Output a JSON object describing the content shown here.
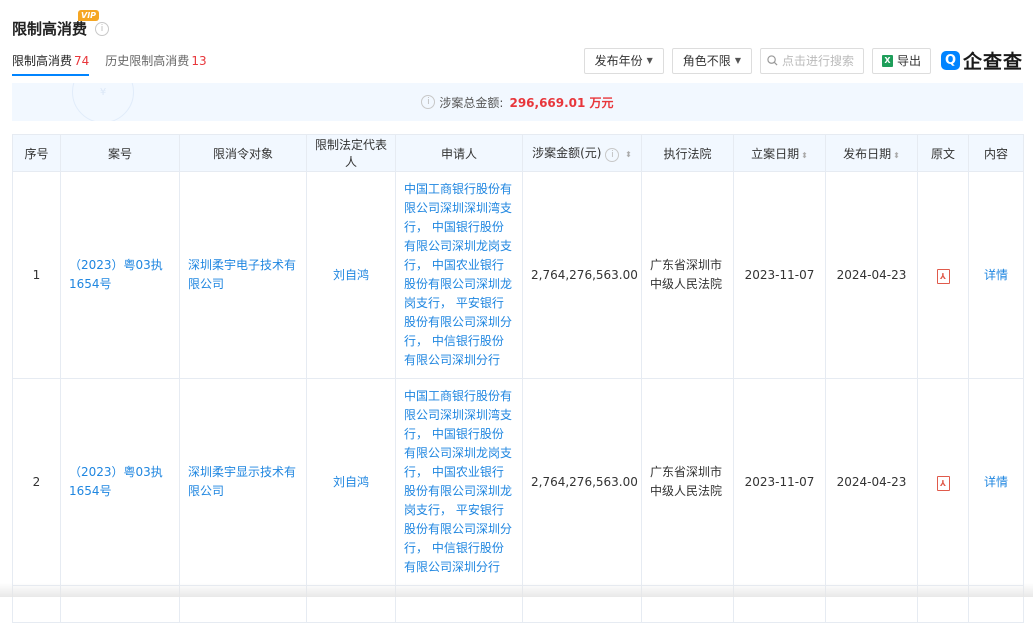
{
  "header": {
    "title": "限制高消费",
    "vip_badge": "VIP",
    "info_icon": "info-icon"
  },
  "tabs": [
    {
      "label": "限制高消费",
      "count": "74",
      "active": true
    },
    {
      "label": "历史限制高消费",
      "count": "13",
      "active": false
    }
  ],
  "toolbar": {
    "year_filter": "发布年份",
    "role_filter": "角色不限",
    "search_placeholder": "点击进行搜索",
    "export_label": "导出",
    "logo_text": "企查查"
  },
  "summary": {
    "label": "涉案总金额:",
    "amount": "296,669.01 万元"
  },
  "table": {
    "headers": [
      "序号",
      "案号",
      "限消令对象",
      "限制法定代表人",
      "申请人",
      "涉案金额(元)",
      "执行法院",
      "立案日期",
      "发布日期",
      "原文",
      "内容"
    ],
    "rows": [
      {
        "index": "1",
        "case_no": "（2023）粤03执1654号",
        "target": "深圳柔宇电子技术有限公司",
        "legal_rep": "刘自鸿",
        "applicant": "中国工商银行股份有限公司深圳深圳湾支行， 中国银行股份有限公司深圳龙岗支行， 中国农业银行股份有限公司深圳龙岗支行， 平安银行股份有限公司深圳分行， 中信银行股份有限公司深圳分行",
        "amount": "2,764,276,563.00",
        "court": "广东省深圳市中级人民法院",
        "filing_date": "2023-11-07",
        "publish_date": "2024-04-23",
        "detail": "详情"
      },
      {
        "index": "2",
        "case_no": "（2023）粤03执1654号",
        "target": "深圳柔宇显示技术有限公司",
        "legal_rep": "刘自鸿",
        "applicant": "中国工商银行股份有限公司深圳深圳湾支行， 中国银行股份有限公司深圳龙岗支行， 中国农业银行股份有限公司深圳龙岗支行， 平安银行股份有限公司深圳分行， 中信银行股份有限公司深圳分行",
        "amount": "2,764,276,563.00",
        "court": "广东省深圳市中级人民法院",
        "filing_date": "2023-11-07",
        "publish_date": "2024-04-23",
        "detail": "详情"
      }
    ]
  },
  "colors": {
    "accent": "#0084ff",
    "link": "#1f86e0",
    "count_red": "#e8363b",
    "header_bg": "#f2f8ff"
  }
}
